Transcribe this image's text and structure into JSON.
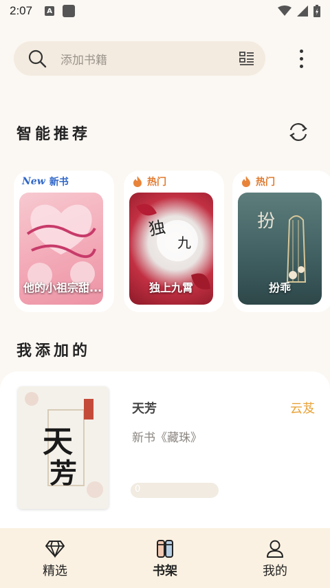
{
  "status_bar": {
    "time": "2:07",
    "notif_letter": "A"
  },
  "search": {
    "placeholder": "添加书籍"
  },
  "recommend": {
    "title": "智能推荐",
    "cards": [
      {
        "tag_badge": "New",
        "tag": "新书",
        "title": "他的小祖宗甜...",
        "tag_style": "new"
      },
      {
        "tag": "热门",
        "title": "独上九霄",
        "tag_style": "hot"
      },
      {
        "tag": "热门",
        "title": "扮乖",
        "tag_style": "hot"
      }
    ]
  },
  "added": {
    "title": "我添加的",
    "book": {
      "title": "天芳",
      "author": "云芨",
      "description": "新书《藏珠》",
      "progress_label": "0",
      "progress": 0
    }
  },
  "colors": {
    "accent": "#e8a33a",
    "hot": "#e07a2f",
    "new": "#2f66c8",
    "background": "#fbf7f2"
  },
  "nav": [
    {
      "label": "精选",
      "icon": "diamond-icon"
    },
    {
      "label": "书架",
      "icon": "bookshelf-icon",
      "active": true
    },
    {
      "label": "我的",
      "icon": "person-icon"
    }
  ]
}
